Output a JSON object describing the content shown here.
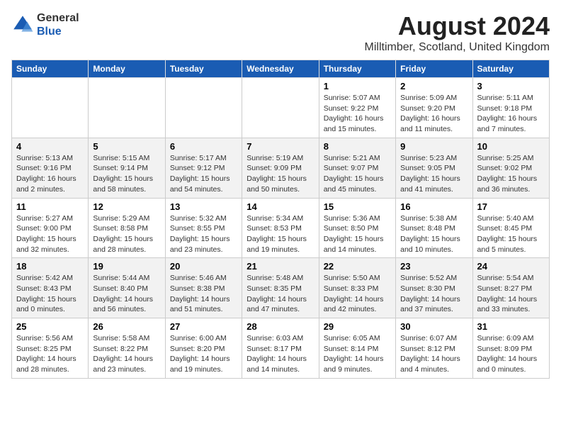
{
  "logo": {
    "text_general": "General",
    "text_blue": "Blue"
  },
  "title": "August 2024",
  "subtitle": "Milltimber, Scotland, United Kingdom",
  "days_of_week": [
    "Sunday",
    "Monday",
    "Tuesday",
    "Wednesday",
    "Thursday",
    "Friday",
    "Saturday"
  ],
  "weeks": [
    [
      {
        "day": "",
        "info": ""
      },
      {
        "day": "",
        "info": ""
      },
      {
        "day": "",
        "info": ""
      },
      {
        "day": "",
        "info": ""
      },
      {
        "day": "1",
        "info": "Sunrise: 5:07 AM\nSunset: 9:22 PM\nDaylight: 16 hours\nand 15 minutes."
      },
      {
        "day": "2",
        "info": "Sunrise: 5:09 AM\nSunset: 9:20 PM\nDaylight: 16 hours\nand 11 minutes."
      },
      {
        "day": "3",
        "info": "Sunrise: 5:11 AM\nSunset: 9:18 PM\nDaylight: 16 hours\nand 7 minutes."
      }
    ],
    [
      {
        "day": "4",
        "info": "Sunrise: 5:13 AM\nSunset: 9:16 PM\nDaylight: 16 hours\nand 2 minutes."
      },
      {
        "day": "5",
        "info": "Sunrise: 5:15 AM\nSunset: 9:14 PM\nDaylight: 15 hours\nand 58 minutes."
      },
      {
        "day": "6",
        "info": "Sunrise: 5:17 AM\nSunset: 9:12 PM\nDaylight: 15 hours\nand 54 minutes."
      },
      {
        "day": "7",
        "info": "Sunrise: 5:19 AM\nSunset: 9:09 PM\nDaylight: 15 hours\nand 50 minutes."
      },
      {
        "day": "8",
        "info": "Sunrise: 5:21 AM\nSunset: 9:07 PM\nDaylight: 15 hours\nand 45 minutes."
      },
      {
        "day": "9",
        "info": "Sunrise: 5:23 AM\nSunset: 9:05 PM\nDaylight: 15 hours\nand 41 minutes."
      },
      {
        "day": "10",
        "info": "Sunrise: 5:25 AM\nSunset: 9:02 PM\nDaylight: 15 hours\nand 36 minutes."
      }
    ],
    [
      {
        "day": "11",
        "info": "Sunrise: 5:27 AM\nSunset: 9:00 PM\nDaylight: 15 hours\nand 32 minutes."
      },
      {
        "day": "12",
        "info": "Sunrise: 5:29 AM\nSunset: 8:58 PM\nDaylight: 15 hours\nand 28 minutes."
      },
      {
        "day": "13",
        "info": "Sunrise: 5:32 AM\nSunset: 8:55 PM\nDaylight: 15 hours\nand 23 minutes."
      },
      {
        "day": "14",
        "info": "Sunrise: 5:34 AM\nSunset: 8:53 PM\nDaylight: 15 hours\nand 19 minutes."
      },
      {
        "day": "15",
        "info": "Sunrise: 5:36 AM\nSunset: 8:50 PM\nDaylight: 15 hours\nand 14 minutes."
      },
      {
        "day": "16",
        "info": "Sunrise: 5:38 AM\nSunset: 8:48 PM\nDaylight: 15 hours\nand 10 minutes."
      },
      {
        "day": "17",
        "info": "Sunrise: 5:40 AM\nSunset: 8:45 PM\nDaylight: 15 hours\nand 5 minutes."
      }
    ],
    [
      {
        "day": "18",
        "info": "Sunrise: 5:42 AM\nSunset: 8:43 PM\nDaylight: 15 hours\nand 0 minutes."
      },
      {
        "day": "19",
        "info": "Sunrise: 5:44 AM\nSunset: 8:40 PM\nDaylight: 14 hours\nand 56 minutes."
      },
      {
        "day": "20",
        "info": "Sunrise: 5:46 AM\nSunset: 8:38 PM\nDaylight: 14 hours\nand 51 minutes."
      },
      {
        "day": "21",
        "info": "Sunrise: 5:48 AM\nSunset: 8:35 PM\nDaylight: 14 hours\nand 47 minutes."
      },
      {
        "day": "22",
        "info": "Sunrise: 5:50 AM\nSunset: 8:33 PM\nDaylight: 14 hours\nand 42 minutes."
      },
      {
        "day": "23",
        "info": "Sunrise: 5:52 AM\nSunset: 8:30 PM\nDaylight: 14 hours\nand 37 minutes."
      },
      {
        "day": "24",
        "info": "Sunrise: 5:54 AM\nSunset: 8:27 PM\nDaylight: 14 hours\nand 33 minutes."
      }
    ],
    [
      {
        "day": "25",
        "info": "Sunrise: 5:56 AM\nSunset: 8:25 PM\nDaylight: 14 hours\nand 28 minutes."
      },
      {
        "day": "26",
        "info": "Sunrise: 5:58 AM\nSunset: 8:22 PM\nDaylight: 14 hours\nand 23 minutes."
      },
      {
        "day": "27",
        "info": "Sunrise: 6:00 AM\nSunset: 8:20 PM\nDaylight: 14 hours\nand 19 minutes."
      },
      {
        "day": "28",
        "info": "Sunrise: 6:03 AM\nSunset: 8:17 PM\nDaylight: 14 hours\nand 14 minutes."
      },
      {
        "day": "29",
        "info": "Sunrise: 6:05 AM\nSunset: 8:14 PM\nDaylight: 14 hours\nand 9 minutes."
      },
      {
        "day": "30",
        "info": "Sunrise: 6:07 AM\nSunset: 8:12 PM\nDaylight: 14 hours\nand 4 minutes."
      },
      {
        "day": "31",
        "info": "Sunrise: 6:09 AM\nSunset: 8:09 PM\nDaylight: 14 hours\nand 0 minutes."
      }
    ]
  ]
}
